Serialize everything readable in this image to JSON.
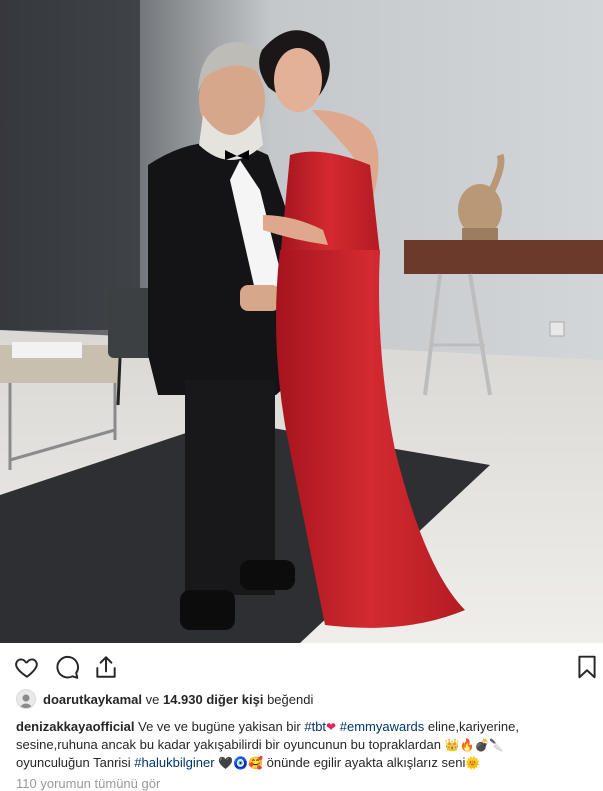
{
  "post": {
    "likes": {
      "user": "doarutkaykamal",
      "connector": "ve",
      "count_text": "14.930 diğer kişi",
      "suffix": "beğendi"
    },
    "caption": {
      "author": "denizakkayaofficial",
      "text_1": "Ve ve ve bugüne yakisan bir",
      "tag_tbt": "#tbt",
      "emoji_1": "❤",
      "tag_emmy": "#emmyawards",
      "text_2": "eline,kariyerine,",
      "line_2": "sesine,ruhuna ancak bu kadar yakışabilirdi bir oyuncunun bu topraklardan",
      "emoji_2": "👑🔥💣🔪",
      "line_3_prefix": "oyunculuğun Tanrisi",
      "tag_haluk": "#halukbilginer",
      "emoji_3": "🖤🧿🥰",
      "line_3_suffix": "önünde egilir ayakta alkışlarız seni",
      "emoji_4": "🌞"
    },
    "comments_link": "110 yorumun tümünü gör"
  },
  "icons": {
    "like": "heart-icon",
    "comment": "comment-icon",
    "share": "share-icon",
    "save": "bookmark-icon"
  },
  "colors": {
    "hashtag": "#003569",
    "text": "#262626",
    "muted": "#999999"
  }
}
